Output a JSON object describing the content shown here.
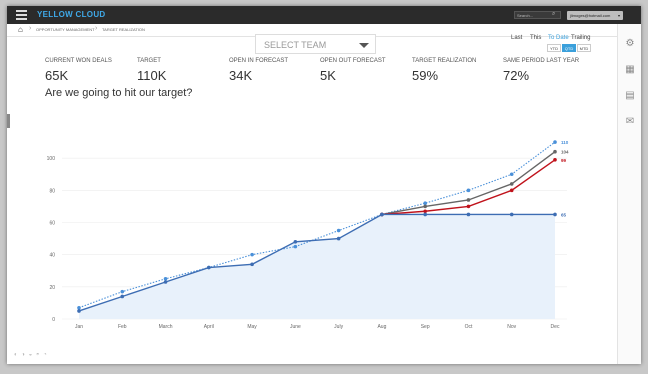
{
  "app": {
    "brand": "YELLOW CLOUD"
  },
  "header": {
    "search_placeholder": "Search...",
    "user_email": "jlimoges@hotmail.com"
  },
  "breadcrumb": [
    "OPPORTUNITY MANAGEMENT",
    "TARGET REALIZATION"
  ],
  "team_select": {
    "value": "SELECT TEAM"
  },
  "period": {
    "tabs": [
      {
        "label": "Last",
        "active": false
      },
      {
        "label": "This",
        "active": false
      },
      {
        "label": "To Date",
        "active": true
      },
      {
        "label": "Trailing",
        "active": false
      }
    ],
    "segments": [
      {
        "label": "YTD",
        "active": false
      },
      {
        "label": "QTD",
        "active": true
      },
      {
        "label": "MTD",
        "active": false
      }
    ]
  },
  "kpis": [
    {
      "label": "CURRENT WON DEALS",
      "value": "65K"
    },
    {
      "label": "TARGET",
      "value": "110K"
    },
    {
      "label": "OPEN IN FORECAST",
      "value": "34K"
    },
    {
      "label": "OPEN OUT FORECAST",
      "value": "5K"
    },
    {
      "label": "TARGET REALIZATION",
      "value": "59%"
    },
    {
      "label": "SAME PERIOD LAST YEAR",
      "value": "72%"
    }
  ],
  "question": "Are we going to hit our target?",
  "chart_data": {
    "type": "line",
    "categories": [
      "Jan",
      "Feb",
      "March",
      "April",
      "May",
      "June",
      "July",
      "Aug",
      "Sep",
      "Oct",
      "Nov",
      "Dec"
    ],
    "ylim": [
      0,
      120
    ],
    "yticks": [
      0,
      20,
      40,
      60,
      80,
      100
    ],
    "grid": true,
    "series": [
      {
        "key": "target",
        "color": "#4a90d9",
        "style": "dotted",
        "values": [
          7,
          17,
          25,
          32,
          40,
          45,
          55,
          65,
          72,
          80,
          90,
          110
        ],
        "end_label": "110"
      },
      {
        "key": "forecast_all",
        "color": "#666666",
        "style": "solid",
        "values": [
          null,
          null,
          null,
          null,
          null,
          null,
          null,
          65,
          70,
          74,
          84,
          104
        ],
        "end_label": "104"
      },
      {
        "key": "forecast_in",
        "color": "#c0121b",
        "style": "solid",
        "values": [
          null,
          null,
          null,
          null,
          null,
          null,
          null,
          65,
          67,
          70,
          80,
          99
        ],
        "end_label": "99"
      },
      {
        "key": "actual",
        "color": "#3d6db3",
        "style": "solid",
        "area": true,
        "values": [
          5,
          14,
          23,
          32,
          34,
          48,
          50,
          65,
          65,
          65,
          65,
          65
        ],
        "end_label": "65"
      }
    ]
  },
  "colors": {
    "accent": "#3ba0db",
    "topbar": "#2b2b2b",
    "area": "#e8f1fb"
  },
  "rail_icons": [
    "gear-plus-icon",
    "calculator-icon",
    "document-list-icon",
    "chat-icon"
  ]
}
